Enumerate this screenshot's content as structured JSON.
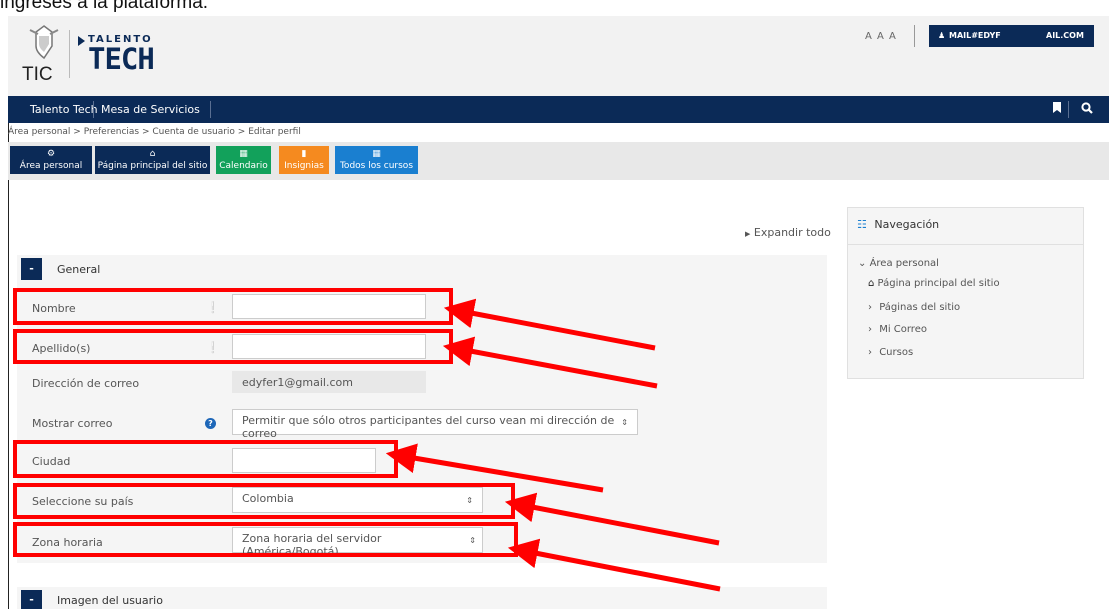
{
  "page_header_text": "ingreses a la plataforma.",
  "header": {
    "tic_label": "TIC",
    "talento_label": "TALENTO",
    "tech_label": "TECH",
    "font_size_label": "A A A",
    "user_email": "MAIL#EDYF",
    "user_email_tail": "AIL.COM"
  },
  "nav": {
    "items": [
      "Talento Tech",
      "Mesa de Servicios"
    ],
    "bookmark_icon": "bookmark-icon",
    "search_icon": "search-icon"
  },
  "breadcrumb": "Área personal > Preferencias > Cuenta de usuario > Editar perfil",
  "quick_buttons": [
    {
      "label": "Área personal",
      "icon": "dashboard-icon",
      "color": "#0b2a57"
    },
    {
      "label": "Página principal del sitio",
      "icon": "home-icon",
      "color": "#0b2a57"
    },
    {
      "label": "Calendario",
      "icon": "calendar-icon",
      "color": "#12a15b"
    },
    {
      "label": "Insignias",
      "icon": "badge-icon",
      "color": "#f58a1f"
    },
    {
      "label": "Todos los cursos",
      "icon": "book-icon",
      "color": "#1a7fd0"
    }
  ],
  "expand_all": "Expandir todo",
  "general": {
    "toggle": "-",
    "title": "General",
    "fields": {
      "nombre_label": "Nombre",
      "apellido_label": "Apellido(s)",
      "correo_label": "Dirección de correo",
      "correo_value": "edyfer1@gmail.com",
      "mostrar_label": "Mostrar correo",
      "mostrar_value": "Permitir que sólo otros participantes del curso vean mi dirección de correo",
      "ciudad_label": "Ciudad",
      "pais_label": "Seleccione su país",
      "pais_value": "Colombia",
      "zona_label": "Zona horaria",
      "zona_value": "Zona horaria del servidor (América/Bogotá)"
    }
  },
  "imagen": {
    "toggle": "-",
    "title": "Imagen del usuario"
  },
  "side_nav": {
    "title": "Navegación",
    "root": "Área personal",
    "items": [
      "Página principal del sitio",
      "Páginas del sitio",
      "Mi Correo",
      "Cursos"
    ]
  },
  "colors": {
    "nav": "#0b2a57",
    "highlight": "#ff0000"
  }
}
